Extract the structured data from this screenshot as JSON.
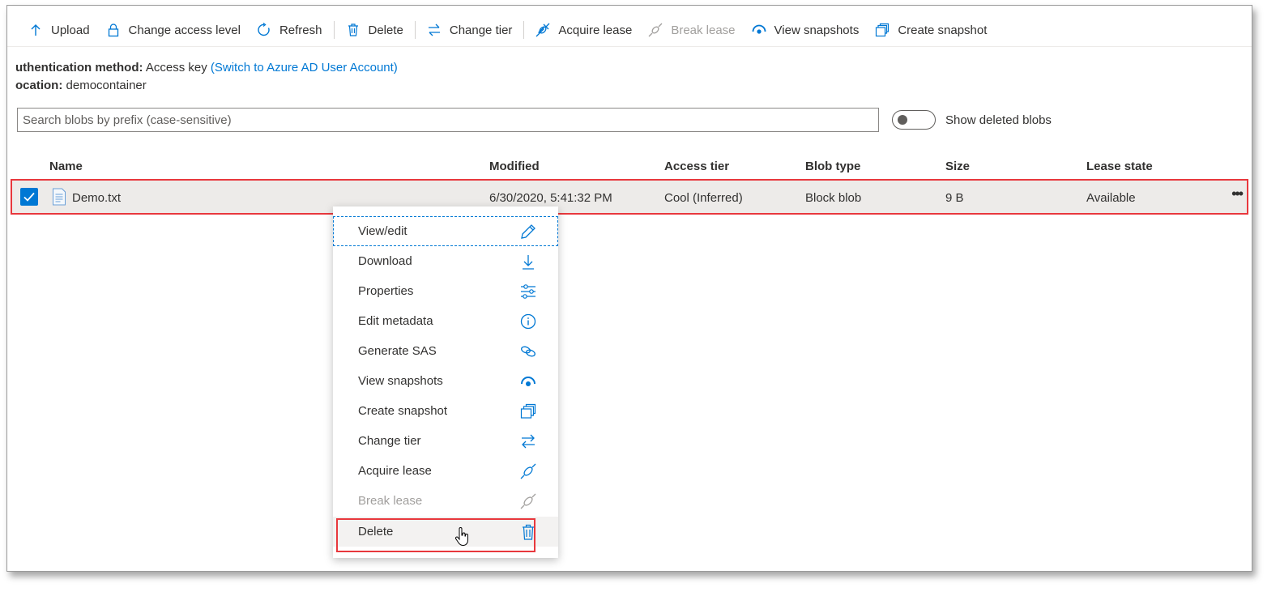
{
  "toolbar": {
    "upload": "Upload",
    "change_access_level": "Change access level",
    "refresh": "Refresh",
    "delete": "Delete",
    "change_tier": "Change tier",
    "acquire_lease": "Acquire lease",
    "break_lease": "Break lease",
    "view_snapshots": "View snapshots",
    "create_snapshot": "Create snapshot"
  },
  "info": {
    "auth_label": "uthentication method:",
    "auth_value": "Access key",
    "auth_link": "(Switch to Azure AD User Account)",
    "location_label": "ocation:",
    "location_value": "democontainer"
  },
  "search": {
    "placeholder": "Search blobs by prefix (case-sensitive)",
    "value": ""
  },
  "toggle": {
    "label": "Show deleted blobs",
    "on": false
  },
  "table": {
    "headers": [
      "Name",
      "Modified",
      "Access tier",
      "Blob type",
      "Size",
      "Lease state"
    ],
    "rows": [
      {
        "name": "Demo.txt",
        "modified": "6/30/2020, 5:41:32 PM",
        "access_tier": "Cool (Inferred)",
        "blob_type": "Block blob",
        "size": "9 B",
        "lease_state": "Available",
        "selected": true
      }
    ]
  },
  "menu": {
    "items": [
      {
        "label": "View/edit",
        "icon": "pencil-icon"
      },
      {
        "label": "Download",
        "icon": "download-icon"
      },
      {
        "label": "Properties",
        "icon": "sliders-icon"
      },
      {
        "label": "Edit metadata",
        "icon": "info-icon"
      },
      {
        "label": "Generate SAS",
        "icon": "link-icon"
      },
      {
        "label": "View snapshots",
        "icon": "eye-icon"
      },
      {
        "label": "Create snapshot",
        "icon": "snapshot-icon"
      },
      {
        "label": "Change tier",
        "icon": "swap-icon"
      },
      {
        "label": "Acquire lease",
        "icon": "plug-icon"
      },
      {
        "label": "Break lease",
        "icon": "plug-icon",
        "disabled": true
      },
      {
        "label": "Delete",
        "icon": "trash-icon"
      }
    ]
  },
  "colors": {
    "accent": "#0078d4",
    "highlight": "#e8383d",
    "text": "#323130",
    "disabled": "#a19f9d"
  }
}
